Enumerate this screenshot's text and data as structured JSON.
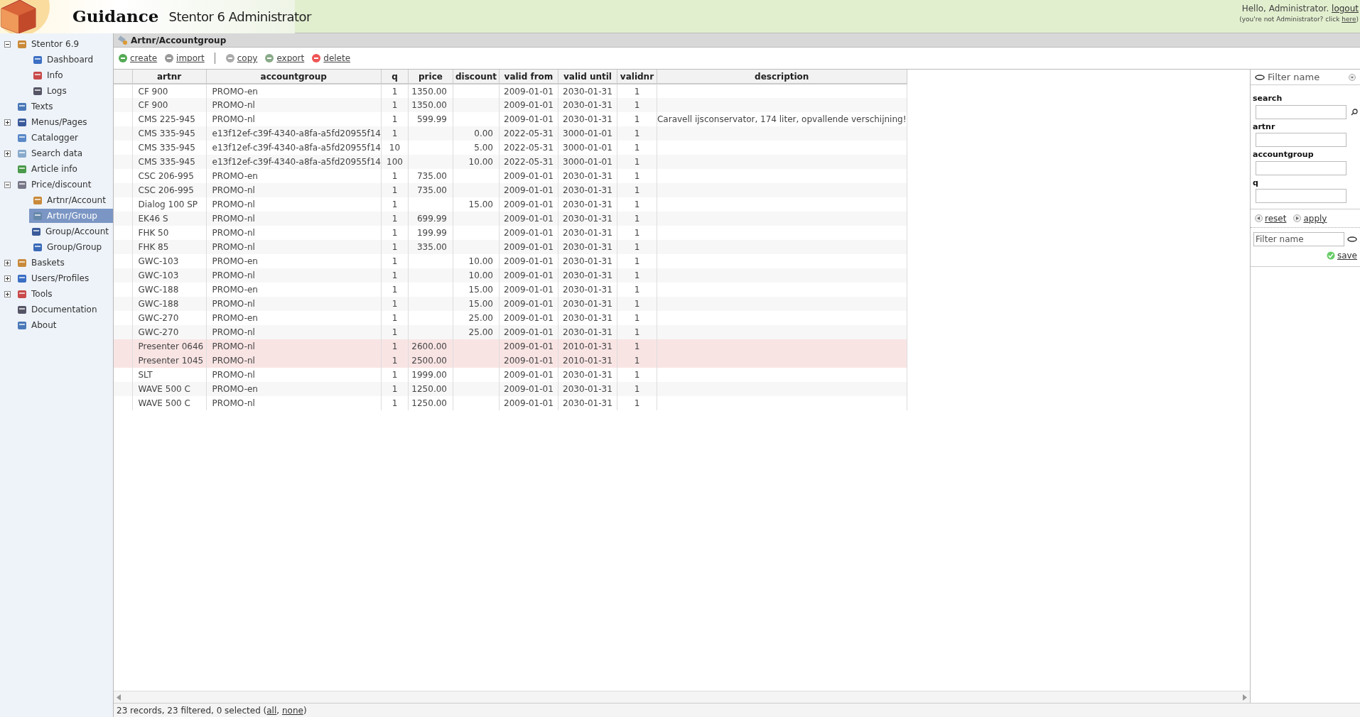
{
  "header": {
    "brand": "Guidance",
    "product": "Stentor 6 Administrator",
    "greeting": "Hello, Administrator.",
    "logout": "logout",
    "note": "(you're not Administrator? click ",
    "note_link": "here",
    "note_end": ")"
  },
  "sidebar": {
    "items": [
      {
        "label": "Stentor 6.9",
        "expanded": true,
        "selected": false,
        "children": [
          {
            "label": "Dashboard",
            "selected": false
          },
          {
            "label": "Info",
            "selected": false
          },
          {
            "label": "Logs",
            "selected": false
          }
        ]
      },
      {
        "label": "Texts",
        "selected": false
      },
      {
        "label": "Menus/Pages",
        "expanded": false,
        "selected": false
      },
      {
        "label": "Catalogger",
        "selected": false
      },
      {
        "label": "Search data",
        "expanded": false,
        "selected": false
      },
      {
        "label": "Article info",
        "selected": false
      },
      {
        "label": "Price/discount",
        "expanded": true,
        "selected": false,
        "children": [
          {
            "label": "Artnr/Account",
            "selected": false
          },
          {
            "label": "Artnr/Group",
            "selected": true
          },
          {
            "label": "Group/Account",
            "selected": false
          },
          {
            "label": "Group/Group",
            "selected": false
          }
        ]
      },
      {
        "label": "Baskets",
        "expanded": false,
        "selected": false
      },
      {
        "label": "Users/Profiles",
        "expanded": false,
        "selected": false
      },
      {
        "label": "Tools",
        "expanded": false,
        "selected": false
      },
      {
        "label": "Documentation",
        "selected": false
      },
      {
        "label": "About",
        "selected": false
      }
    ]
  },
  "page_title": "Artnr/Accountgroup",
  "toolbar": [
    "create",
    "import",
    "copy",
    "export",
    "delete"
  ],
  "table": {
    "columns": [
      "artnr",
      "accountgroup",
      "q",
      "price",
      "discount",
      "valid from",
      "valid until",
      "validnr",
      "description"
    ],
    "rows": [
      {
        "cells": [
          "CF 900",
          "PROMO-en",
          "1",
          "1350.00",
          "",
          "2009-01-01",
          "2030-01-31",
          "1",
          ""
        ],
        "expired": false
      },
      {
        "cells": [
          "CF 900",
          "PROMO-nl",
          "1",
          "1350.00",
          "",
          "2009-01-01",
          "2030-01-31",
          "1",
          ""
        ],
        "expired": false
      },
      {
        "cells": [
          "CMS 225-945",
          "PROMO-nl",
          "1",
          "599.99",
          "",
          "2009-01-01",
          "2030-01-31",
          "1",
          "Caravell ijsconservator, 174 liter, opvallende verschijning!"
        ],
        "expired": false
      },
      {
        "cells": [
          "CMS 335-945",
          "e13f12ef-c39f-4340-a8fa-a5fd20955f14",
          "1",
          "",
          "0.00",
          "2022-05-31",
          "3000-01-01",
          "1",
          ""
        ],
        "expired": false
      },
      {
        "cells": [
          "CMS 335-945",
          "e13f12ef-c39f-4340-a8fa-a5fd20955f14",
          "10",
          "",
          "5.00",
          "2022-05-31",
          "3000-01-01",
          "1",
          ""
        ],
        "expired": false
      },
      {
        "cells": [
          "CMS 335-945",
          "e13f12ef-c39f-4340-a8fa-a5fd20955f14",
          "100",
          "",
          "10.00",
          "2022-05-31",
          "3000-01-01",
          "1",
          ""
        ],
        "expired": false
      },
      {
        "cells": [
          "CSC 206-995",
          "PROMO-en",
          "1",
          "735.00",
          "",
          "2009-01-01",
          "2030-01-31",
          "1",
          ""
        ],
        "expired": false
      },
      {
        "cells": [
          "CSC 206-995",
          "PROMO-nl",
          "1",
          "735.00",
          "",
          "2009-01-01",
          "2030-01-31",
          "1",
          ""
        ],
        "expired": false
      },
      {
        "cells": [
          "Dialog 100 SP",
          "PROMO-nl",
          "1",
          "",
          "15.00",
          "2009-01-01",
          "2030-01-31",
          "1",
          ""
        ],
        "expired": false
      },
      {
        "cells": [
          "EK46 S",
          "PROMO-nl",
          "1",
          "699.99",
          "",
          "2009-01-01",
          "2030-01-31",
          "1",
          ""
        ],
        "expired": false
      },
      {
        "cells": [
          "FHK 50",
          "PROMO-nl",
          "1",
          "199.99",
          "",
          "2009-01-01",
          "2030-01-31",
          "1",
          ""
        ],
        "expired": false
      },
      {
        "cells": [
          "FHK 85",
          "PROMO-nl",
          "1",
          "335.00",
          "",
          "2009-01-01",
          "2030-01-31",
          "1",
          ""
        ],
        "expired": false
      },
      {
        "cells": [
          "GWC-103",
          "PROMO-en",
          "1",
          "",
          "10.00",
          "2009-01-01",
          "2030-01-31",
          "1",
          ""
        ],
        "expired": false
      },
      {
        "cells": [
          "GWC-103",
          "PROMO-nl",
          "1",
          "",
          "10.00",
          "2009-01-01",
          "2030-01-31",
          "1",
          ""
        ],
        "expired": false
      },
      {
        "cells": [
          "GWC-188",
          "PROMO-en",
          "1",
          "",
          "15.00",
          "2009-01-01",
          "2030-01-31",
          "1",
          ""
        ],
        "expired": false
      },
      {
        "cells": [
          "GWC-188",
          "PROMO-nl",
          "1",
          "",
          "15.00",
          "2009-01-01",
          "2030-01-31",
          "1",
          ""
        ],
        "expired": false
      },
      {
        "cells": [
          "GWC-270",
          "PROMO-en",
          "1",
          "",
          "25.00",
          "2009-01-01",
          "2030-01-31",
          "1",
          ""
        ],
        "expired": false
      },
      {
        "cells": [
          "GWC-270",
          "PROMO-nl",
          "1",
          "",
          "25.00",
          "2009-01-01",
          "2030-01-31",
          "1",
          ""
        ],
        "expired": false
      },
      {
        "cells": [
          "Presenter 0646",
          "PROMO-nl",
          "1",
          "2600.00",
          "",
          "2009-01-01",
          "2010-01-31",
          "1",
          ""
        ],
        "expired": true
      },
      {
        "cells": [
          "Presenter 1045",
          "PROMO-nl",
          "1",
          "2500.00",
          "",
          "2009-01-01",
          "2010-01-31",
          "1",
          ""
        ],
        "expired": true
      },
      {
        "cells": [
          "SLT",
          "PROMO-nl",
          "1",
          "1999.00",
          "",
          "2009-01-01",
          "2030-01-31",
          "1",
          ""
        ],
        "expired": false
      },
      {
        "cells": [
          "WAVE 500 C",
          "PROMO-en",
          "1",
          "1250.00",
          "",
          "2009-01-01",
          "2030-01-31",
          "1",
          ""
        ],
        "expired": false
      },
      {
        "cells": [
          "WAVE 500 C",
          "PROMO-nl",
          "1",
          "1250.00",
          "",
          "2009-01-01",
          "2030-01-31",
          "1",
          ""
        ],
        "expired": false
      }
    ]
  },
  "filter_panel": {
    "title": "Filter name",
    "fields": [
      "search",
      "artnr",
      "accountgroup",
      "q"
    ],
    "reset": "reset",
    "apply": "apply",
    "name_placeholder": "Filter name",
    "save": "save"
  },
  "status_bar": [
    {
      "kind": "text",
      "text": "23 records, 23 filtered, 0 selected ("
    },
    {
      "kind": "link",
      "text": "all"
    },
    {
      "kind": "text",
      "text": ", "
    },
    {
      "kind": "link",
      "text": "none"
    },
    {
      "kind": "text",
      "text": ")"
    }
  ]
}
